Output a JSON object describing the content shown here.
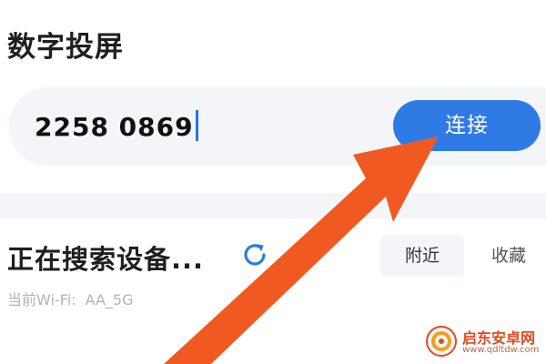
{
  "header": {
    "title": "数字投屏"
  },
  "code_entry": {
    "value": "2258 0869",
    "connect_label": "连接"
  },
  "devices": {
    "status": "正在搜索设备...",
    "refresh_icon": "refresh-icon",
    "tabs": [
      {
        "label": "附近",
        "selected": true
      },
      {
        "label": "收藏",
        "selected": false
      }
    ],
    "wifi_label": "当前Wi-Fi:",
    "wifi_name": "AA_5G"
  },
  "overlay": {
    "arrow_color": "#f05a22"
  },
  "watermark": {
    "name": "启东安卓网",
    "url": "www.qdltdw.com"
  },
  "colors": {
    "accent": "#2e7be6",
    "surface": "#f3f5f8"
  }
}
